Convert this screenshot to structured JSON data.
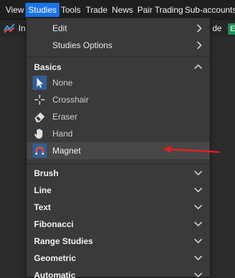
{
  "menubar": {
    "items": [
      "View",
      "Studies",
      "Tools",
      "Trade",
      "News",
      "Pair Trading",
      "Sub-accounts"
    ],
    "active_index": 1
  },
  "background_row": {
    "left_text": "In",
    "right_text": "de",
    "badge_text": "E"
  },
  "dropdown": {
    "top_items": [
      {
        "label": "Edit",
        "icon": "chevron-right-icon"
      },
      {
        "label": "Studies Options",
        "icon": "chevron-right-icon"
      }
    ],
    "basics": {
      "label": "Basics",
      "expanded": true,
      "tools": [
        {
          "label": "None",
          "icon": "cursor-arrow-icon",
          "selected": true
        },
        {
          "label": "Crosshair",
          "icon": "crosshair-icon",
          "selected": false
        },
        {
          "label": "Eraser",
          "icon": "eraser-icon",
          "selected": false
        },
        {
          "label": "Hand",
          "icon": "hand-icon",
          "selected": false
        },
        {
          "label": "Magnet",
          "icon": "magnet-icon",
          "selected": true,
          "highlighted": true
        }
      ]
    },
    "sections": [
      {
        "label": "Brush"
      },
      {
        "label": "Line"
      },
      {
        "label": "Text"
      },
      {
        "label": "Fibonacci"
      },
      {
        "label": "Range Studies"
      },
      {
        "label": "Geometric"
      },
      {
        "label": "Automatic"
      }
    ]
  },
  "colors": {
    "accent": "#1a73e8",
    "annotation_arrow": "#e02020",
    "menu_bg": "#3a3a3a",
    "selected_icon_bg": "#2f5f96",
    "badge": "#1e8f57"
  }
}
